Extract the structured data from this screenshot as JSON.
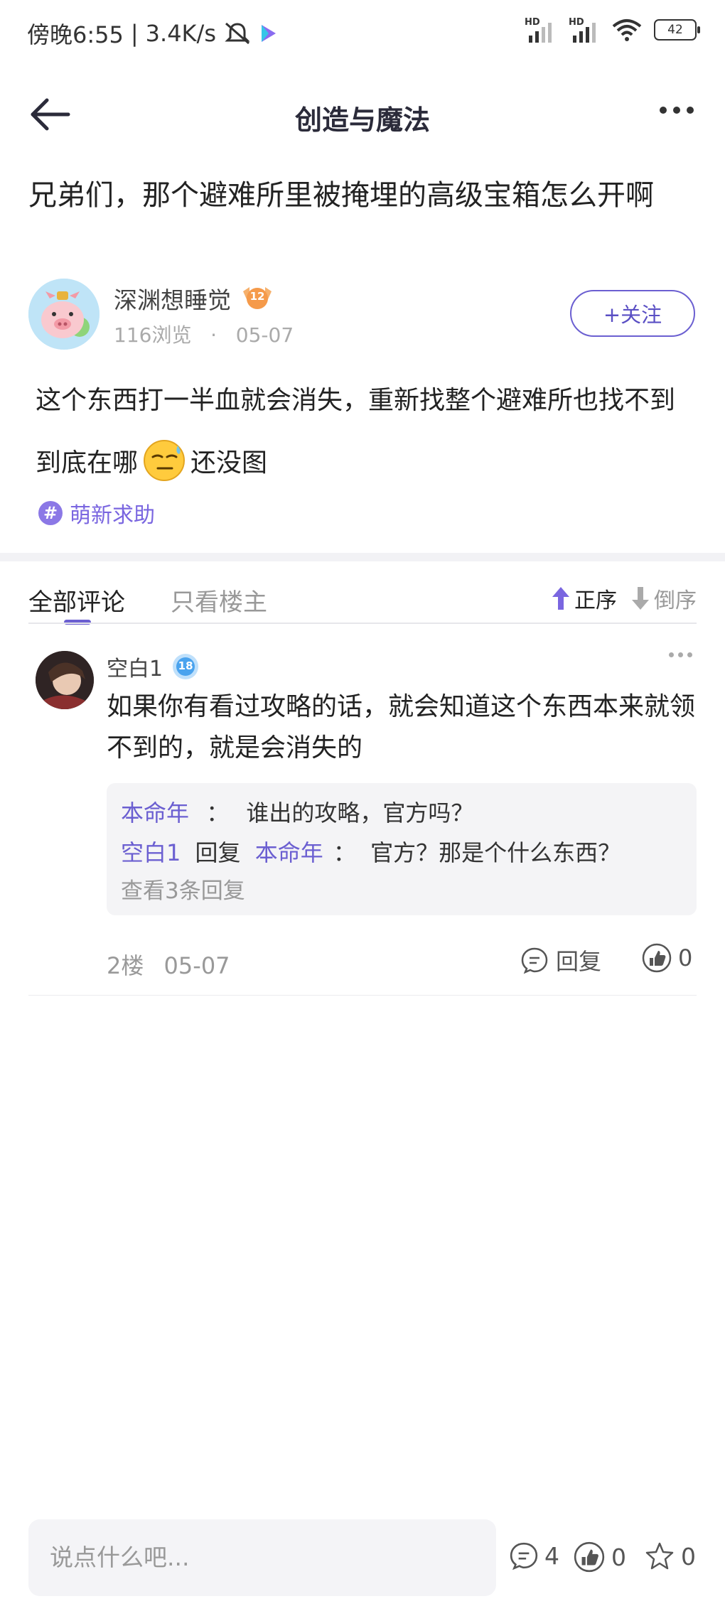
{
  "status_bar": {
    "time": "傍晚6:55",
    "speed": "3.4K/s",
    "sim1_label": "HD",
    "sim2_label": "HD",
    "battery": "42"
  },
  "header": {
    "title": "创造与魔法"
  },
  "post": {
    "title": "兄弟们，那个避难所里被掩埋的高级宝箱怎么开啊",
    "author": "深渊想睡觉",
    "author_level": "12",
    "views": "116浏览",
    "date": "05-07",
    "follow_label": "+关注",
    "content_part1": "这个东西打一半血就会消失，重新找整个避难所也找不到到底在哪",
    "content_part2": "还没图",
    "tag": "萌新求助"
  },
  "comments_section": {
    "tab_all": "全部评论",
    "tab_owner": "只看楼主",
    "sort_asc": "正序",
    "sort_desc": "倒序"
  },
  "comment": {
    "author": "空白1",
    "level": "18",
    "text": "如果你有看过攻略的话，就会知道这个东西本来就领不到的，就是会消失的",
    "replies": [
      {
        "name": "本命年",
        "sep": "：",
        "text": "谁出的攻略，官方吗？"
      },
      {
        "name": "空白1",
        "verb": "回复",
        "target": "本命年",
        "sep": "：",
        "text": "官方？那是个什么东西？"
      }
    ],
    "more_replies": "查看3条回复",
    "floor": "2楼",
    "date": "05-07",
    "reply_label": "回复",
    "likes": "0"
  },
  "bottom_bar": {
    "input_placeholder": "说点什么吧...",
    "comments_count": "4",
    "likes_count": "0",
    "stars_count": "0"
  }
}
